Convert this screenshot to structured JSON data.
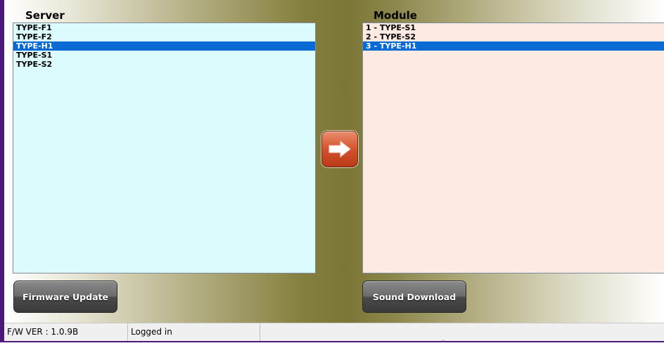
{
  "server_panel": {
    "title": "Server",
    "items": [
      "TYPE-F1",
      "TYPE-F2",
      "TYPE-H1",
      "TYPE-S1",
      "TYPE-S2"
    ],
    "selected": "TYPE-H1"
  },
  "module_panel": {
    "title": "Module",
    "items": [
      "1 - TYPE-S1",
      "2 - TYPE-S2",
      "3 - TYPE-H1"
    ],
    "selected": "3 - TYPE-H1"
  },
  "transfer": {
    "icon": "arrow-right-icon"
  },
  "buttons": {
    "firmware_update": "Firmware Update",
    "sound_download": "Sound Download"
  },
  "status_bar": {
    "fw_version": "F/W VER : 1.0.9B",
    "login_status": "Logged in"
  },
  "stray_glyph": "“",
  "colors": {
    "frame": "#4b1a78",
    "server_list_bg": "#dbfbfd",
    "module_list_bg": "#fdeae2",
    "selection": "#0a6ad4",
    "transfer_button": "#d4532c"
  }
}
